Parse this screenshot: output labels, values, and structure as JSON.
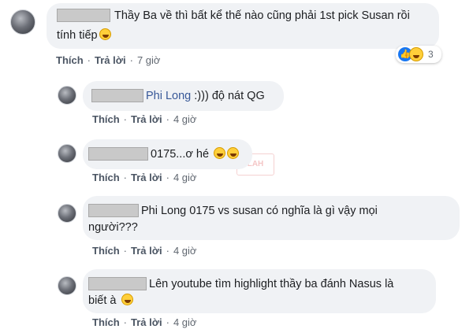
{
  "colors": {
    "bubble": "#f0f2f5",
    "name_link": "#385898",
    "action_text": "#606770",
    "like_blue": "#1877f2"
  },
  "comments": [
    {
      "level": "top",
      "text_line1": "Thầy Ba về thì bất kể thế nào cũng phải 1st pick Susan rồi",
      "text_line2": "tính tiếp",
      "emoji": "rofl-emoji",
      "actions": {
        "like": "Thích",
        "reply": "Trả lời",
        "time": "7 giờ"
      },
      "reactions": {
        "icons": [
          "like-icon",
          "haha-icon"
        ],
        "count": "3"
      }
    },
    {
      "level": "reply",
      "name": "Phi Long",
      "text_line1": " :))) độ nát QG",
      "actions": {
        "like": "Thích",
        "reply": "Trả lời",
        "time": "4 giờ"
      }
    },
    {
      "level": "reply",
      "text_line1": "0175...ơ hé ",
      "emoji": [
        "rofl-emoji",
        "rofl-emoji"
      ],
      "actions": {
        "like": "Thích",
        "reply": "Trả lời",
        "time": "4 giờ"
      }
    },
    {
      "level": "reply",
      "text_line1": "Phi Long 0175 vs susan có nghĩa là gì vậy mọi",
      "text_line2": "người???",
      "actions": {
        "like": "Thích",
        "reply": "Trả lời",
        "time": "4 giờ"
      }
    },
    {
      "level": "reply",
      "text_line1": "Lên youtube tìm highlight thầy ba đánh Nasus là",
      "text_line2": "biết à ",
      "emoji": "rofl-emoji",
      "actions": {
        "like": "Thích",
        "reply": "Trả lời",
        "time": "4 giờ"
      }
    }
  ]
}
